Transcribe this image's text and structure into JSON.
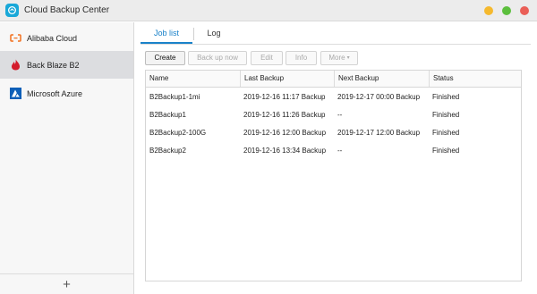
{
  "window": {
    "title": "Cloud Backup Center",
    "controls": {
      "minimize_color": "#f5b92e",
      "maximize_color": "#5cbf3d",
      "close_color": "#ea5f57"
    }
  },
  "sidebar": {
    "items": [
      {
        "label": "Alibaba Cloud",
        "icon": "alibaba-cloud-icon",
        "active": false
      },
      {
        "label": "Back Blaze B2",
        "icon": "backblaze-flame-icon",
        "active": true
      },
      {
        "label": "Microsoft Azure",
        "icon": "azure-icon",
        "active": false
      }
    ],
    "add_label": "+"
  },
  "tabs": [
    {
      "label": "Job list",
      "active": true
    },
    {
      "label": "Log",
      "active": false
    }
  ],
  "toolbar": {
    "create": "Create",
    "backup_now": "Back up now",
    "edit": "Edit",
    "info": "Info",
    "more": "More",
    "more_caret": "▾"
  },
  "table": {
    "headers": [
      "Name",
      "Last Backup",
      "Next Backup",
      "Status"
    ],
    "rows": [
      [
        "B2Backup1-1mi",
        "2019-12-16 11:17 Backup",
        "2019-12-17 00:00 Backup",
        "Finished"
      ],
      [
        "B2Backup1",
        "2019-12-16 11:26 Backup",
        "--",
        "Finished"
      ],
      [
        "B2Backup2-100G",
        "2019-12-16 12:00 Backup",
        "2019-12-17 12:00 Backup",
        "Finished"
      ],
      [
        "B2Backup2",
        "2019-12-16 13:34 Backup",
        "--",
        "Finished"
      ]
    ]
  },
  "colors": {
    "accent": "#1a82c9",
    "app_icon": "#19a8d8",
    "alibaba": "#f2701f",
    "backblaze": "#d41b2c",
    "azure": "#0d5fb8"
  }
}
